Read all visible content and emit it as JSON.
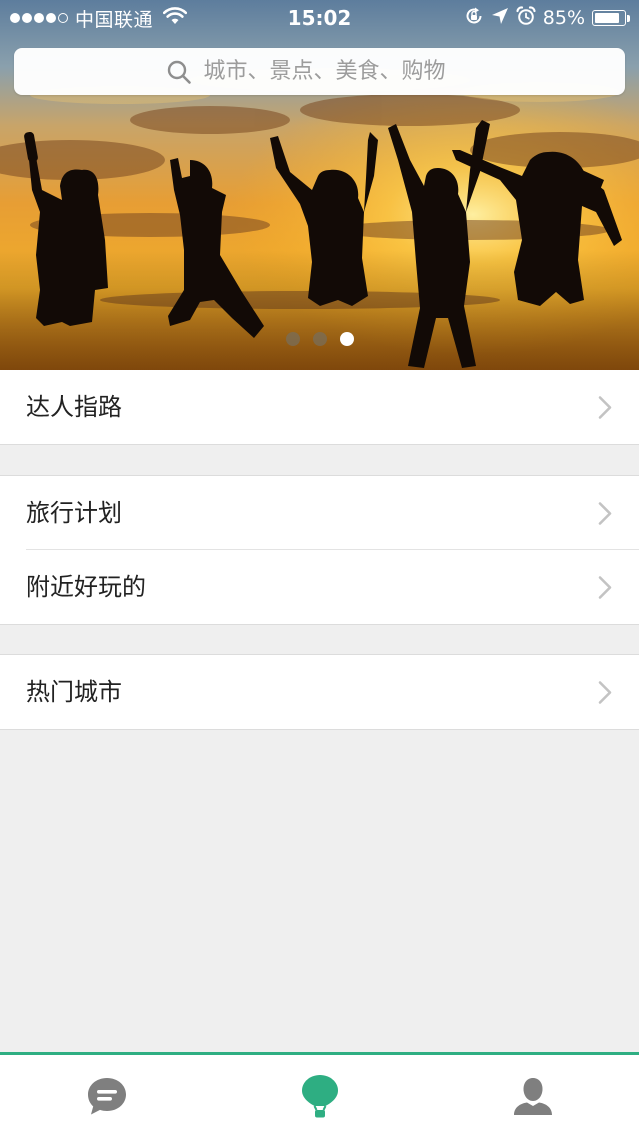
{
  "status_bar": {
    "carrier": "中国联通",
    "time": "15:02",
    "battery_percent_text": "85%",
    "battery_level": 0.85,
    "signal_bars_filled": 4,
    "signal_bars_total": 5,
    "icons": [
      "wifi-icon",
      "orientation-lock-icon",
      "location-arrow-icon",
      "alarm-icon",
      "battery-icon"
    ]
  },
  "search": {
    "placeholder": "城市、景点、美食、购物",
    "icon": "search-icon"
  },
  "banner": {
    "image": "silhouettes of five people jumping against a sunset sky",
    "page_count": 3,
    "active_page": 3
  },
  "menu": {
    "items": [
      {
        "label": "达人指路",
        "icon": "chevron-right-icon"
      },
      {
        "label": "旅行计划",
        "icon": "chevron-right-icon"
      },
      {
        "label": "附近好玩的",
        "icon": "chevron-right-icon"
      },
      {
        "label": "热门城市",
        "icon": "chevron-right-icon"
      }
    ]
  },
  "tab_bar": {
    "tabs": [
      {
        "name": "messages",
        "icon": "chat-bubble-icon",
        "active": false
      },
      {
        "name": "explore",
        "icon": "balloon-icon",
        "active": true
      },
      {
        "name": "profile",
        "icon": "user-icon",
        "active": false
      }
    ]
  },
  "colors": {
    "accent": "#2eae82",
    "inactive_icon": "#7f7f7f",
    "background": "#efefef",
    "row_background": "#ffffff",
    "chevron": "#c3c3c3"
  }
}
